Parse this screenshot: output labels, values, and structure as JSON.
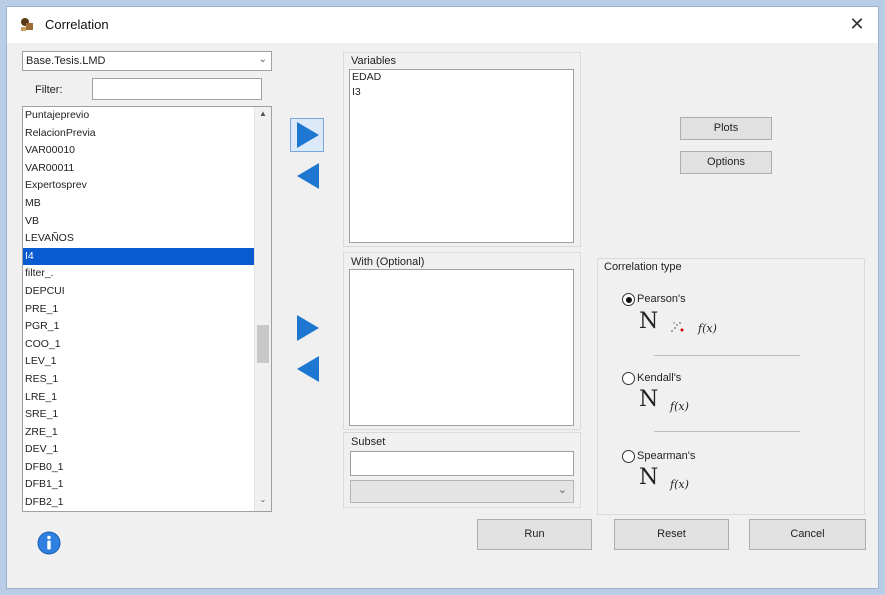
{
  "window": {
    "title": "Correlation",
    "close_glyph": "✕"
  },
  "dataset": {
    "selected": "Base.Tesis.LMD",
    "filter_label": "Filter:",
    "filter_value": ""
  },
  "source_list": {
    "items": [
      "Puntajeprevio",
      "RelacionPrevia",
      "VAR00010",
      "VAR00011",
      "Expertosprev",
      "MB",
      "VB",
      "LEVAÑOS",
      "I4",
      "filter_.",
      "DEPCUI",
      "PRE_1",
      "PGR_1",
      "COO_1",
      "LEV_1",
      "RES_1",
      "LRE_1",
      "SRE_1",
      "ZRE_1",
      "DEV_1",
      "DFB0_1",
      "DFB1_1",
      "DFB2_1"
    ],
    "selected_index": 8
  },
  "variables": {
    "label": "Variables",
    "items": [
      "EDAD",
      "I3"
    ]
  },
  "with": {
    "label": "With (Optional)",
    "items": []
  },
  "subset": {
    "label": "Subset",
    "value": "",
    "select_value": ""
  },
  "buttons": {
    "plots": "Plots",
    "options": "Options",
    "run": "Run",
    "reset": "Reset",
    "cancel": "Cancel"
  },
  "correlation_type": {
    "label": "Correlation type",
    "options": [
      {
        "label": "Pearson's",
        "checked": true,
        "n": "N",
        "f": "f(x)"
      },
      {
        "label": "Kendall's",
        "checked": false,
        "n": "N",
        "f": "f(x)"
      },
      {
        "label": "Spearman's",
        "checked": false,
        "n": "N",
        "f": "f(x)"
      }
    ]
  },
  "colors": {
    "arrow_blue": "#1e78d2",
    "selection": "#0a5bd1",
    "info_blue": "#2f80e0"
  }
}
